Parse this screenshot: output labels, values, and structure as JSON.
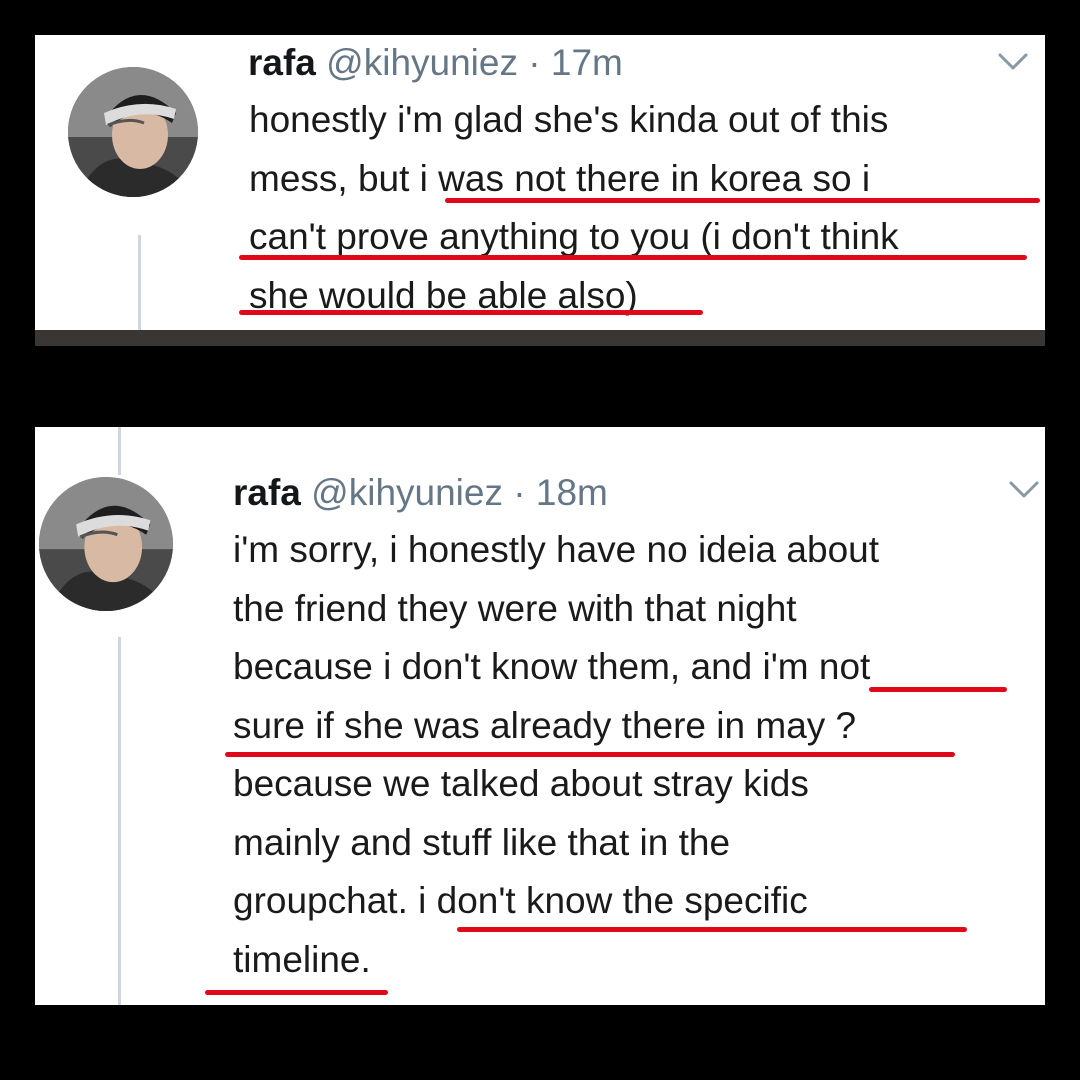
{
  "tweets": [
    {
      "name": "rafa",
      "handle": "@kihyuniez",
      "separator": "·",
      "time": "17m",
      "lines": [
        "honestly i'm glad she's kinda out of this",
        "mess, but i was not there in korea so i",
        "can't prove anything to you (i don't think",
        "she would be able also)"
      ],
      "icons": {
        "avatar": "profile-photo",
        "menu": "chevron-down-icon"
      }
    },
    {
      "name": "rafa",
      "handle": "@kihyuniez",
      "separator": "·",
      "time": "18m",
      "lines": [
        "i'm sorry, i honestly have no ideia about",
        "the friend they were with that night",
        "because i don't know them, and i'm not",
        "sure if she was already there in may ?",
        "because we talked about stray kids",
        "mainly and stuff like that in the",
        "groupchat. i don't know the specific",
        "timeline."
      ],
      "icons": {
        "avatar": "profile-photo",
        "menu": "chevron-down-icon"
      }
    }
  ],
  "colors": {
    "highlight_underline": "#e0081b",
    "name": "#14171a",
    "secondary": "#657786"
  }
}
